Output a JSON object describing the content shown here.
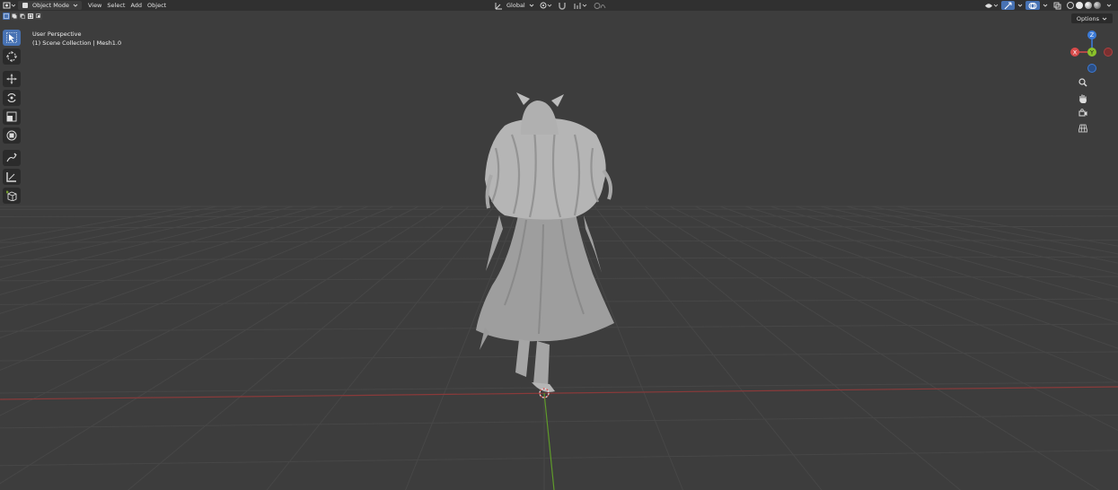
{
  "header": {
    "mode_label": "Object Mode",
    "menus": [
      "View",
      "Select",
      "Add",
      "Object"
    ],
    "transform_orientation": "Global"
  },
  "overlay": {
    "view_name": "User Perspective",
    "collection_info": "(1) Scene Collection | Mesh1.0"
  },
  "options_label": "Options",
  "gizmo": {
    "x_label": "X",
    "y_label": "Y",
    "z_label": "Z"
  },
  "toolbar": {
    "tools": [
      "select-box",
      "cursor",
      "move",
      "rotate",
      "scale",
      "transform",
      "annotate",
      "measure",
      "add-cube"
    ],
    "active_tool": "select-box"
  },
  "colors": {
    "viewport_bg": "#3d3d3d",
    "header_bg": "#303030",
    "accent": "#4772b3",
    "x_axis": "#d94b4b",
    "y_axis": "#8bc22b",
    "z_axis": "#3c7bd8",
    "mesh": "#a8a8a8"
  }
}
